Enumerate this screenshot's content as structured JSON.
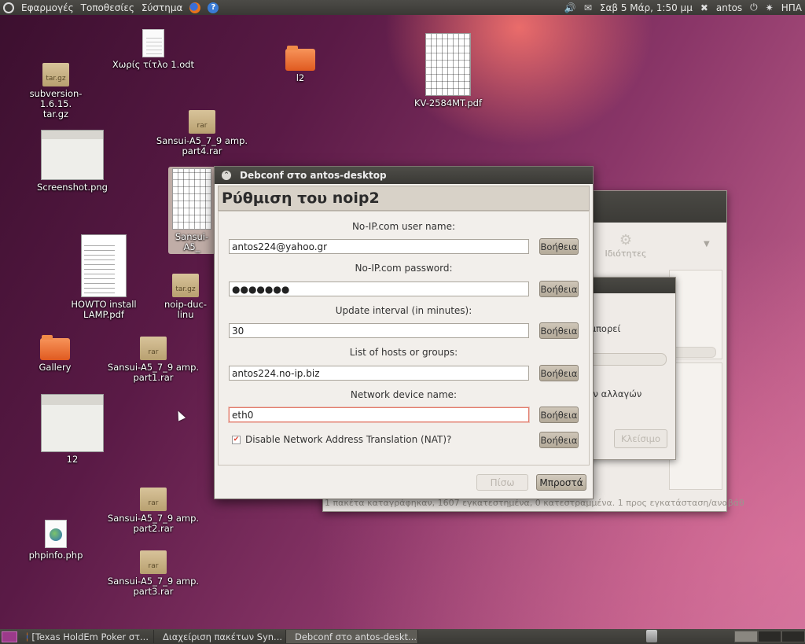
{
  "top_panel": {
    "menu": [
      "Εφαρμογές",
      "Τοποθεσίες",
      "Σύστημα"
    ],
    "clock": "Σαβ  5 Μάρ, 1:50 μμ",
    "user": "antos",
    "keyboard": "ΗΠΑ"
  },
  "desktop_icons": [
    {
      "label": "subversion-1.6.15.\ntar.gz",
      "ext": "tar.gz"
    },
    {
      "label": "Χωρίς τίτλο 1.odt"
    },
    {
      "label": "l2"
    },
    {
      "label": "KV-2584MT.pdf"
    },
    {
      "label": "Sansui-A5_7_9 amp.\npart4.rar",
      "ext": "rar"
    },
    {
      "label": "Screenshot.png"
    },
    {
      "label": "Sansui-A5_"
    },
    {
      "label": "HOWTO install\nLAMP.pdf"
    },
    {
      "label": "noip-duc-linu",
      "ext": "tar.gz"
    },
    {
      "label": "Gallery"
    },
    {
      "label": "Sansui-A5_7_9 amp.\npart1.rar",
      "ext": "rar"
    },
    {
      "label": "12"
    },
    {
      "label": "Sansui-A5_7_9 amp.\npart2.rar",
      "ext": "rar"
    },
    {
      "label": "phpinfo.php"
    },
    {
      "label": "Sansui-A5_7_9 amp.\npart3.rar",
      "ext": "rar"
    }
  ],
  "synaptic": {
    "properties_label": "Ιδιότητες",
    "status": "1 πακέτα καταγράφηκαν, 1607 εγκατεστημένα, 0 κατεστραμμένα. 1 προς εγκατάσταση/αναβάθ"
  },
  "progress_win": {
    "text1": "ό μπορεί",
    "text2": "..",
    "text3": "των αλλαγών",
    "close_label": "Κλείσιμο"
  },
  "dialog": {
    "title": "Debconf στο antos-desktop",
    "header": "Ρύθμιση του noip2",
    "help_label": "Βοήθεια",
    "fields": [
      {
        "label": "No-IP.com user name:",
        "value": "antos224@yahoo.gr"
      },
      {
        "label": "No-IP.com password:",
        "value": "●●●●●●●"
      },
      {
        "label": "Update interval (in minutes):",
        "value": "30"
      },
      {
        "label": "List of hosts or groups:",
        "value": "antos224.no-ip.biz"
      },
      {
        "label": "Network device name:",
        "value": "eth0"
      }
    ],
    "checkbox_label": "Disable Network Address Translation (NAT)?",
    "back_label": "Πίσω",
    "next_label": "Μπροστά"
  },
  "taskbar": [
    {
      "label": "[Texas HoldEm Poker στ..."
    },
    {
      "label": "Διαχείριση πακέτων Syn..."
    },
    {
      "label": "Debconf στο antos-deskt..."
    }
  ]
}
